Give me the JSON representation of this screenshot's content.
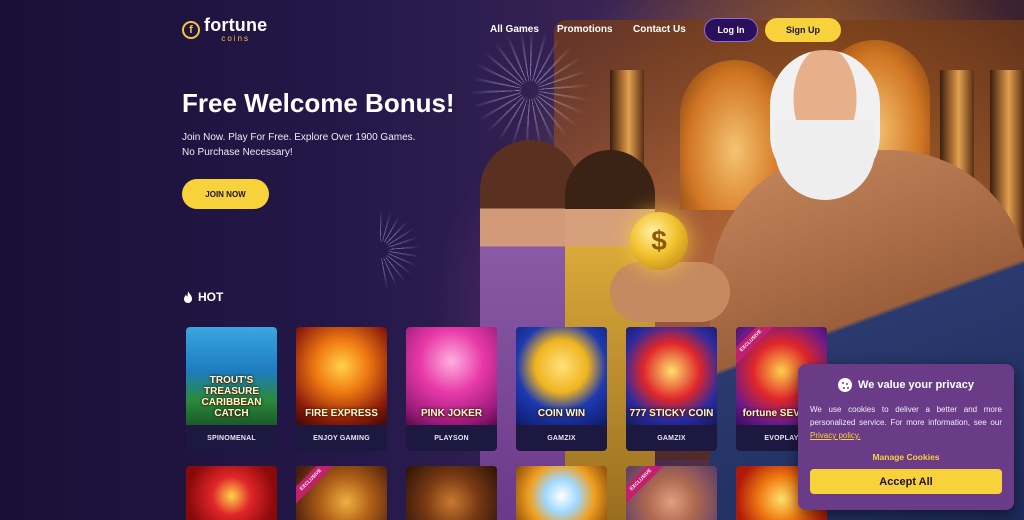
{
  "header": {
    "logo_main": "fortune",
    "logo_sub": "coins",
    "nav": [
      {
        "label": "All Games"
      },
      {
        "label": "Promotions"
      },
      {
        "label": "Contact Us"
      }
    ],
    "login_label": "Log In",
    "signup_label": "Sign Up"
  },
  "hero": {
    "title": "Free Welcome Bonus!",
    "subtitle_line1": "Join Now. Play For Free. Explore Over 1900 Games.",
    "subtitle_line2": "No Purchase Necessary!",
    "cta_label": "JOIN NOW"
  },
  "hot": {
    "label": "HOT",
    "games": [
      {
        "title": "TROUT'S TREASURE CARIBBEAN CATCH",
        "provider": "SPINOMENAL",
        "exclusive": false
      },
      {
        "title": "FIRE EXPRESS",
        "provider": "ENJOY GAMING",
        "exclusive": false
      },
      {
        "title": "PINK JOKER",
        "provider": "PLAYSON",
        "exclusive": false
      },
      {
        "title": "COIN WIN",
        "provider": "GAMZIX",
        "exclusive": false
      },
      {
        "title": "777 STICKY COIN",
        "provider": "GAMZIX",
        "exclusive": false
      },
      {
        "title": "fortune SEVENS",
        "provider": "EVOPLAY",
        "exclusive": true,
        "badge": "EXCLUSIVE"
      }
    ],
    "second_row_badges": [
      "",
      "EXCLUSIVE",
      "",
      "",
      "EXCLUSIVE",
      ""
    ]
  },
  "cookie": {
    "title": "We value your privacy",
    "body": "We use cookies to deliver a better and more personalized service. For more information, see our",
    "link": "Privacy policy.",
    "manage_label": "Manage Cookies",
    "accept_label": "Accept All"
  },
  "colors": {
    "accent": "#f8d23a",
    "login_bg": "#2a0f5a",
    "cookie_bg": "#6a3c88",
    "exclusive_badge": "#c21f6e"
  }
}
